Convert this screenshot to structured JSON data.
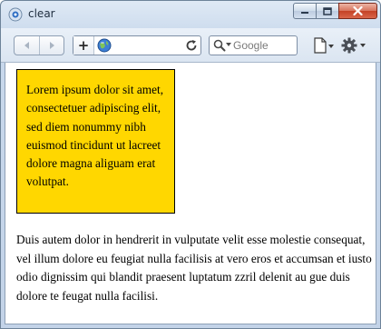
{
  "window": {
    "title": "clear"
  },
  "toolbar": {
    "back_icon": "back-arrow-icon",
    "forward_icon": "forward-arrow-icon",
    "add_tab_label": "+",
    "address_value": "",
    "search_placeholder": "Google"
  },
  "content": {
    "box_text": "Lorem ipsum dolor sit amet, consectetuer adipiscing elit, sed diem nonummy nibh euismod tincidunt ut lacreet dolore magna aliguam erat volutpat.",
    "paragraph_text": "Duis autem dolor in hendrerit in vulputate velit esse molestie consequat, vel illum dolore eu feugiat nulla facilisis at vero eros et accumsan et iusto odio dignissim qui blandit praesent luptatum zzril delenit au gue duis dolore te feugat nulla facilisi."
  },
  "colors": {
    "box_background": "#ffd700",
    "close_button": "#c44125",
    "window_frame": "#c9d9ec"
  }
}
